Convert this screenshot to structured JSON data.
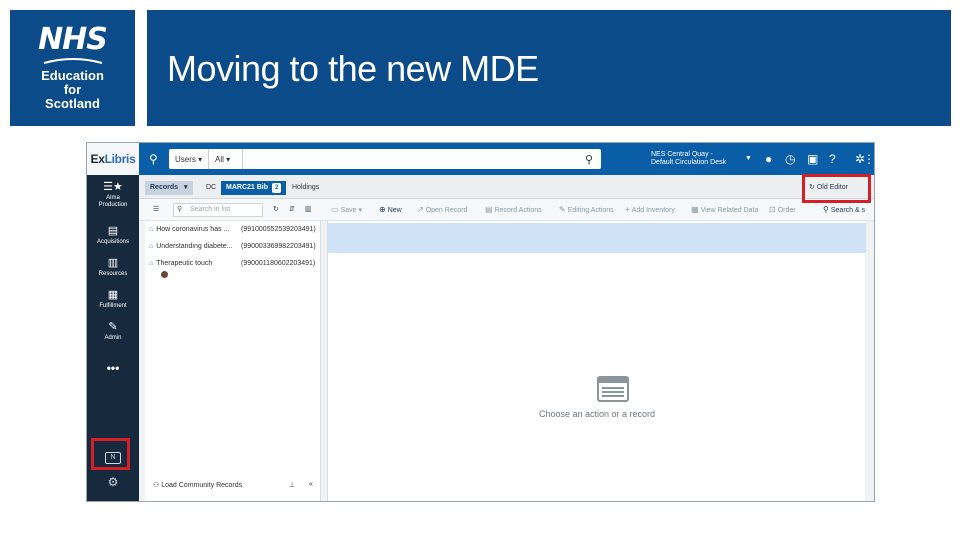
{
  "header": {
    "logo": {
      "line1": "NHS",
      "line2": "Education",
      "line3": "for",
      "line4": "Scotland"
    },
    "title": "Moving to the new MDE"
  },
  "colors": {
    "brand_blue": "#0b4b8a",
    "topbar_blue": "#0a5ea8",
    "nav_dark": "#16293d",
    "highlight_red": "#d41f26",
    "selected_row": "#cfe2f6"
  },
  "app": {
    "brand": {
      "part1": "Ex",
      "part2": "Libris"
    },
    "search": {
      "scope": "Users",
      "field": "All",
      "value": ""
    },
    "location": {
      "line1": "NES Central Quay -",
      "line2": "Default Circulation Desk"
    },
    "topbar_icons": [
      "user-icon",
      "history-icon",
      "tasks-icon",
      "help-icon",
      "settings-icon",
      "more-vertical-icon"
    ],
    "nav": [
      {
        "icon": "star-icon",
        "label1": "Alma",
        "label2": "Production"
      },
      {
        "icon": "acquisitions-icon",
        "label1": "Acquisitions",
        "label2": ""
      },
      {
        "icon": "resources-icon",
        "label1": "Resources",
        "label2": ""
      },
      {
        "icon": "fulfillment-icon",
        "label1": "Fulfillment",
        "label2": ""
      },
      {
        "icon": "admin-icon",
        "label1": "Admin",
        "label2": ""
      }
    ],
    "nav_more": "•••",
    "tabs": {
      "records": "Records",
      "dc": "DC",
      "marc": "MARC21 Bib",
      "marc_count": "2",
      "holdings": "Holdings"
    },
    "old_editor": "Old Editor",
    "toolbar": {
      "list_search_placeholder": "Search in list",
      "save": "Save",
      "new": "New",
      "open_record": "Open Record",
      "record_actions": "Record Actions",
      "editing_actions": "Editing Actions",
      "add_inventory": "Add Inventory",
      "view_related_data": "View Related Data",
      "order": "Order",
      "search_and": "Search & s"
    },
    "records": [
      {
        "title": "How coronavirus has ...",
        "mms": "(991000552539203491)"
      },
      {
        "title": "Understanding diabete...",
        "mms": "(990003369982203491)"
      },
      {
        "title": "Therapeutic touch",
        "mms": "(990001180602203491)"
      }
    ],
    "community": "Load Community Records",
    "empty_state": "Choose an action or a record"
  }
}
